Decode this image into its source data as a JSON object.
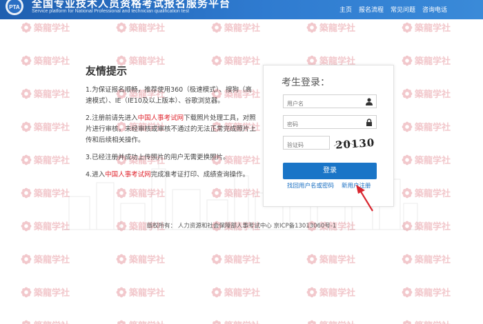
{
  "header": {
    "site_title": "全国专业技术人员资格考试报名服务平台",
    "site_subtitle": "Service platform for National Professional and technician qualification test",
    "logo_text": "PTA",
    "nav": [
      "主页",
      "报名流程",
      "常见问题",
      "咨询电话"
    ]
  },
  "tips": {
    "title": "友情提示",
    "items": [
      {
        "before": "1.为保证报名顺畅，推荐使用360（极速模式）、搜狗（高速模式）、IE（IE10及以上版本）、谷歌浏览器。",
        "link": "",
        "after": ""
      },
      {
        "before": "2.注册前请先进入",
        "link": "中国人事考试网",
        "after": "下载照片处理工具，对照片进行审核，未经审核或审核不通过的无法正常完成照片上传和后续相关操作。"
      },
      {
        "before": "3.已经注册并成功上传照片的用户无需更换照片。",
        "link": "",
        "after": ""
      },
      {
        "before": "4.进入",
        "link": "中国人事考试网",
        "after": "完成准考证打印、成绩查询操作。"
      }
    ]
  },
  "login": {
    "title": "考生登录：",
    "username_placeholder": "用户名",
    "password_placeholder": "密码",
    "captcha_placeholder": "验证码",
    "captcha_text": "20130",
    "submit_label": "登录",
    "forgot_link": "找回用户名或密码",
    "register_link": "新用户注册"
  },
  "footer": {
    "text": "版权所有：  人力资源和社会保障部人事考试中心 京ICP备13013060号-1"
  },
  "watermark": {
    "text": "築龍学社"
  },
  "colors": {
    "header_blue": "#2a6fc4",
    "button_blue": "#1a75c7",
    "link_red": "#e0262f",
    "arrow_red": "#d9262f",
    "watermark_pink": "#f2c8cc"
  }
}
